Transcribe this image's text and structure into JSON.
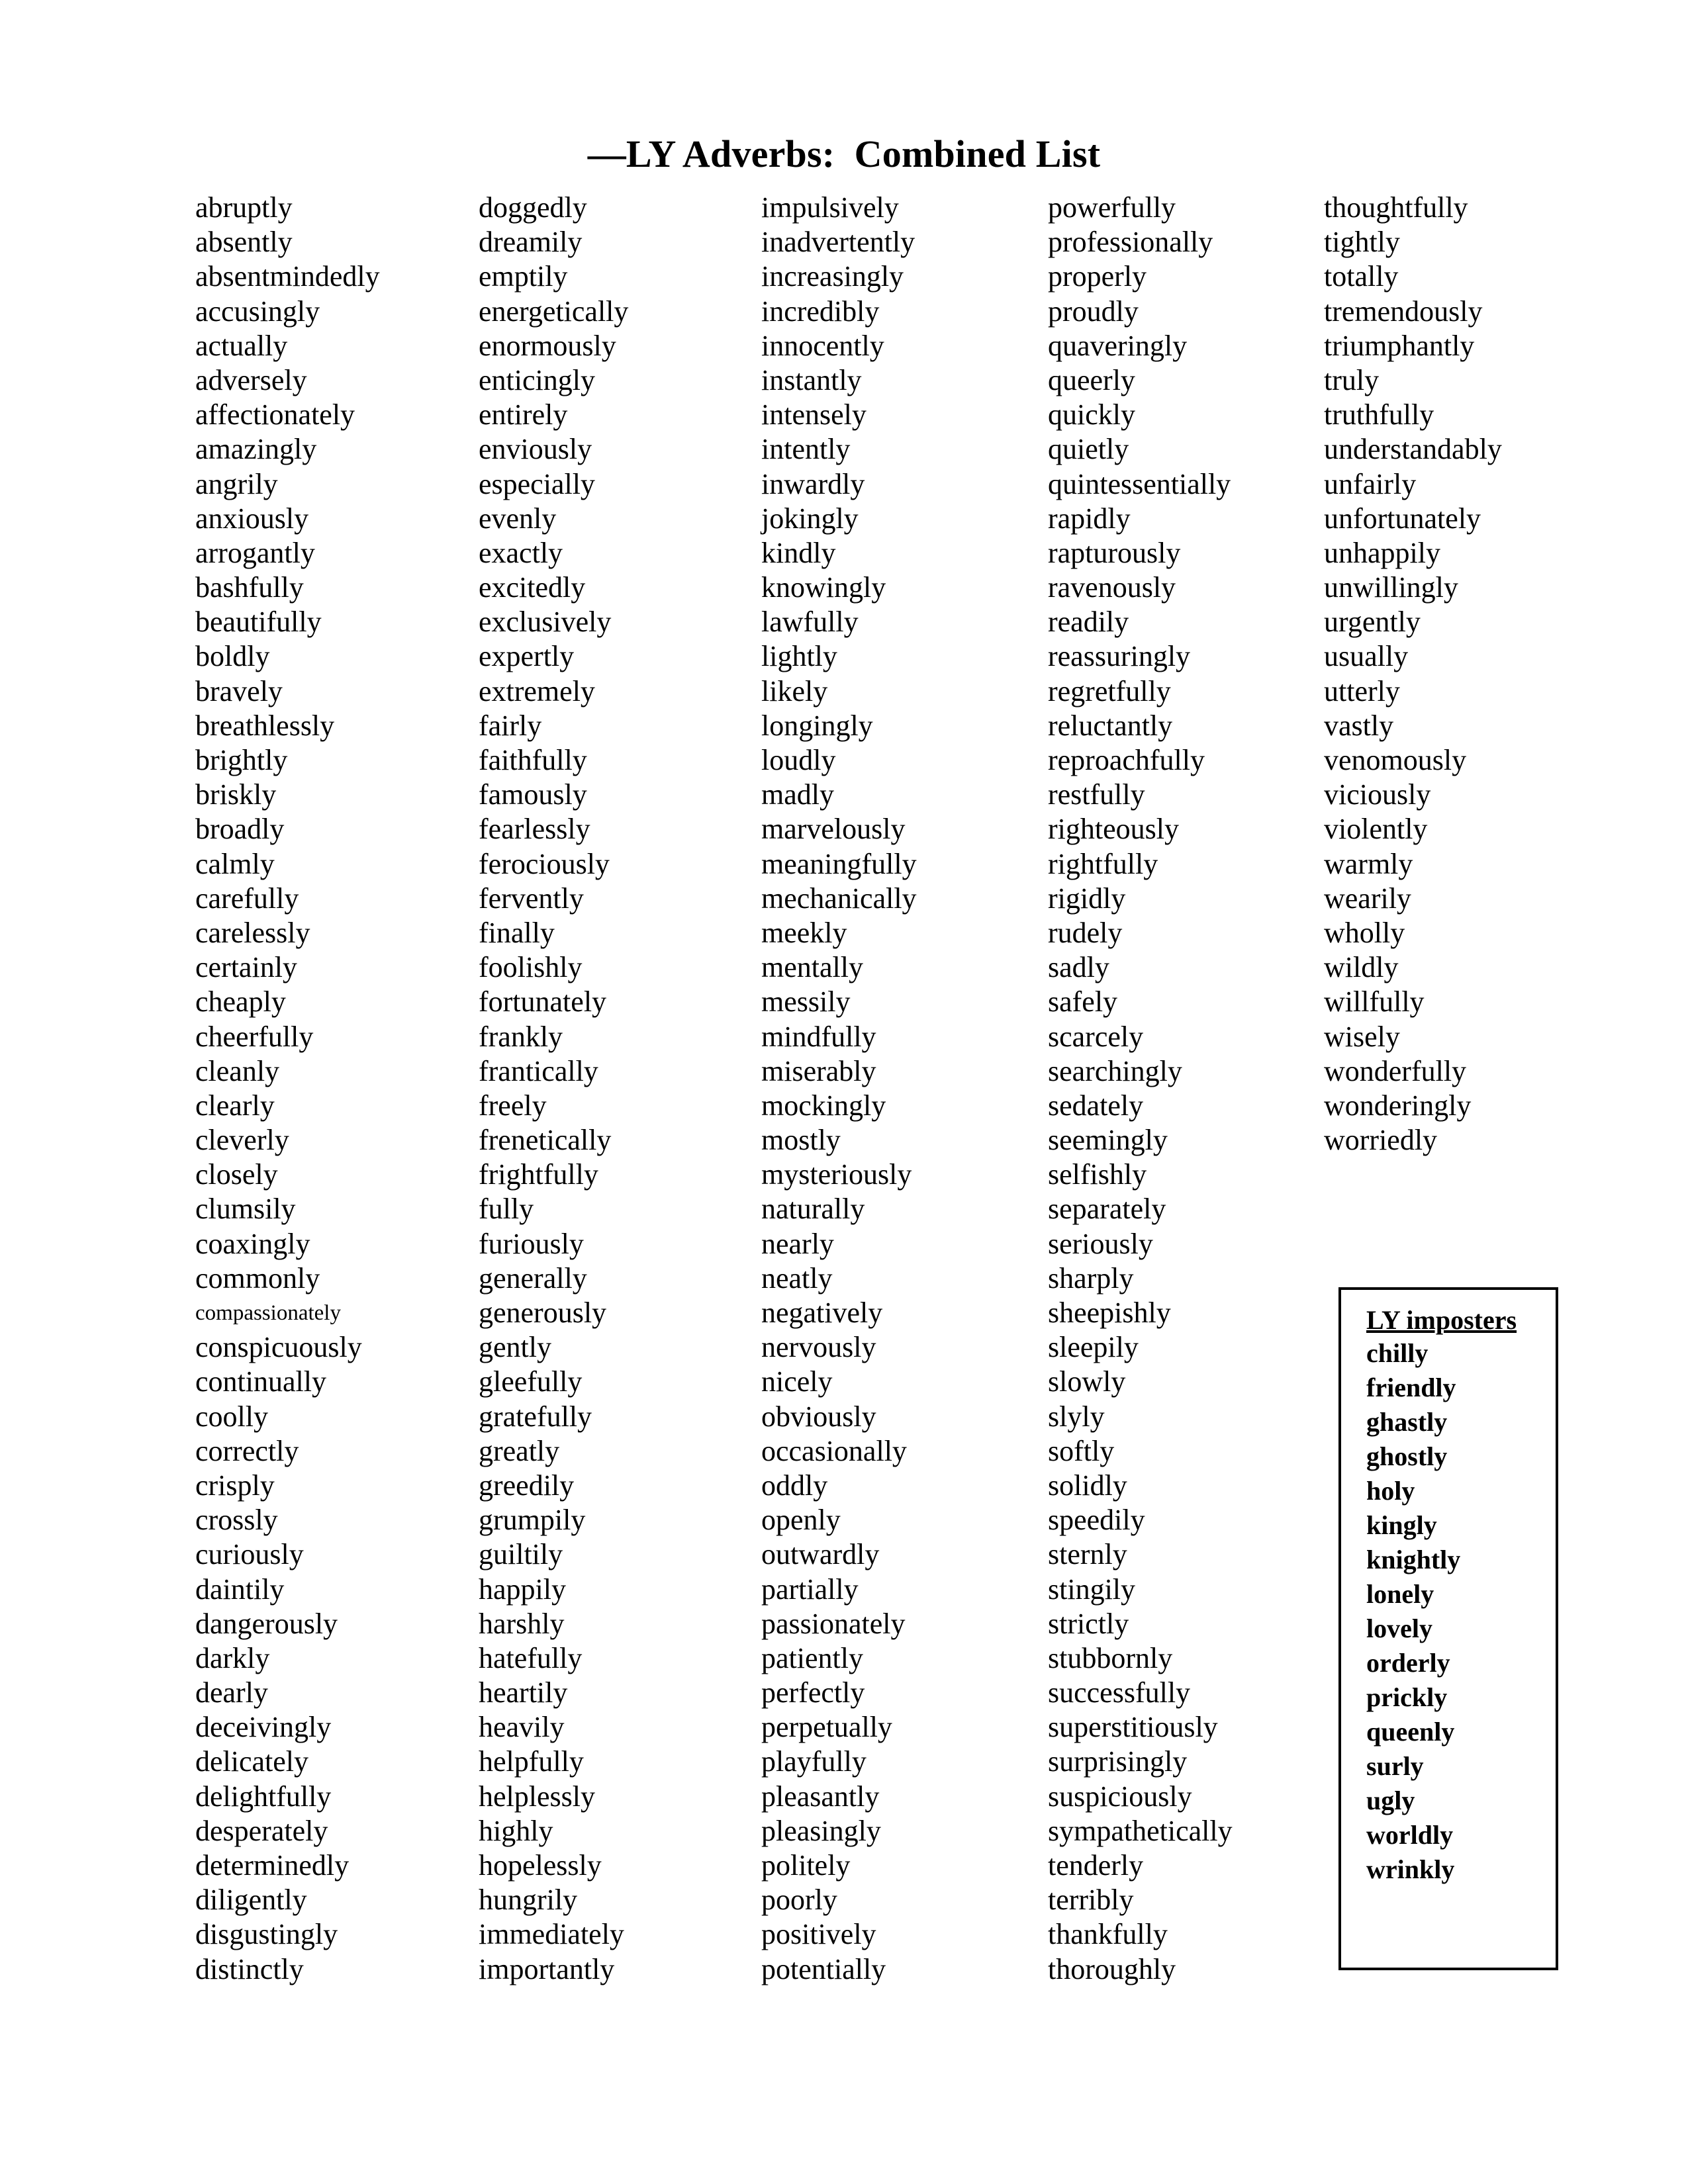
{
  "document": {
    "title": "—LY Adverbs:  Combined List"
  },
  "columns": [
    {
      "id": "column-1",
      "words": [
        "abruptly",
        "absently",
        "absentmindedly",
        "accusingly",
        "actually",
        "adversely",
        "affectionately",
        "amazingly",
        "angrily",
        "anxiously",
        "arrogantly",
        "bashfully",
        "beautifully",
        "boldly",
        "bravely",
        "breathlessly",
        "brightly",
        "briskly",
        "broadly",
        "calmly",
        "carefully",
        "carelessly",
        "certainly",
        "cheaply",
        "cheerfully",
        "cleanly",
        "clearly",
        "cleverly",
        "closely",
        "clumsily",
        "coaxingly",
        "commonly",
        "compassionately",
        "conspicuously",
        "continually",
        "coolly",
        "correctly",
        "crisply",
        "crossly",
        "curiously",
        "daintily",
        "dangerously",
        "darkly",
        "dearly",
        "deceivingly",
        "delicately",
        "delightfully",
        "desperately",
        "determinedly",
        "diligently",
        "disgustingly",
        "distinctly"
      ],
      "small_indices": [
        32
      ]
    },
    {
      "id": "column-2",
      "words": [
        "doggedly",
        "dreamily",
        "emptily",
        "energetically",
        "enormously",
        "enticingly",
        "entirely",
        "enviously",
        "especially",
        "evenly",
        "exactly",
        "excitedly",
        "exclusively",
        "expertly",
        "extremely",
        "fairly",
        "faithfully",
        "famously",
        "fearlessly",
        "ferociously",
        "fervently",
        "finally",
        "foolishly",
        "fortunately",
        "frankly",
        "frantically",
        "freely",
        "frenetically",
        "frightfully",
        "fully",
        "furiously",
        "generally",
        "generously",
        "gently",
        "gleefully",
        "gratefully",
        "greatly",
        "greedily",
        "grumpily",
        "guiltily",
        "happily",
        "harshly",
        "hatefully",
        "heartily",
        "heavily",
        "helpfully",
        "helplessly",
        "highly",
        "hopelessly",
        "hungrily",
        "immediately",
        "importantly"
      ],
      "small_indices": []
    },
    {
      "id": "column-3",
      "words": [
        "impulsively",
        "inadvertently",
        "increasingly",
        "incredibly",
        "innocently",
        "instantly",
        "intensely",
        "intently",
        "inwardly",
        "jokingly",
        "kindly",
        "knowingly",
        "lawfully",
        "lightly",
        "likely",
        "longingly",
        "loudly",
        "madly",
        "marvelously",
        "meaningfully",
        "mechanically",
        "meekly",
        "mentally",
        "messily",
        "mindfully",
        "miserably",
        "mockingly",
        "mostly",
        "mysteriously",
        "naturally",
        "nearly",
        "neatly",
        "negatively",
        "nervously",
        "nicely",
        "obviously",
        "occasionally",
        "oddly",
        "openly",
        "outwardly",
        "partially",
        "passionately",
        "patiently",
        "perfectly",
        "perpetually",
        "playfully",
        "pleasantly",
        "pleasingly",
        "politely",
        "poorly",
        "positively",
        "potentially"
      ],
      "small_indices": []
    },
    {
      "id": "column-4",
      "words": [
        "powerfully",
        "professionally",
        "properly",
        "proudly",
        "quaveringly",
        "queerly",
        "quickly",
        "quietly",
        "quintessentially",
        "rapidly",
        "rapturously",
        "ravenously",
        "readily",
        "reassuringly",
        "regretfully",
        "reluctantly",
        "reproachfully",
        "restfully",
        "righteously",
        "rightfully",
        "rigidly",
        "rudely",
        "sadly",
        "safely",
        "scarcely",
        "searchingly",
        "sedately",
        "seemingly",
        "selfishly",
        "separately",
        "seriously",
        "sharply",
        "sheepishly",
        "sleepily",
        "slowly",
        "slyly",
        "softly",
        "solidly",
        "speedily",
        "sternly",
        "stingily",
        "strictly",
        "stubbornly",
        "successfully",
        "superstitiously",
        "surprisingly",
        "suspiciously",
        "sympathetically",
        "tenderly",
        "terribly",
        "thankfully",
        "thoroughly"
      ],
      "small_indices": []
    },
    {
      "id": "column-5",
      "words": [
        "thoughtfully",
        "tightly",
        "totally",
        "tremendously",
        "triumphantly",
        "truly",
        "truthfully",
        "understandably",
        "unfairly",
        "unfortunately",
        "unhappily",
        "unwillingly",
        "urgently",
        "usually",
        "utterly",
        "vastly",
        "venomously",
        "viciously",
        "violently",
        "warmly",
        "wearily",
        "wholly",
        "wildly",
        "willfully",
        "wisely",
        "wonderfully",
        "wonderingly",
        "worriedly"
      ],
      "small_indices": []
    }
  ],
  "imposters_box": {
    "heading": "LY imposters",
    "words": [
      "chilly",
      "friendly",
      "ghastly",
      "ghostly",
      "holy",
      "kingly",
      "knightly",
      "lonely",
      "lovely",
      "orderly",
      "prickly",
      "queenly",
      "surly",
      "ugly",
      "worldly",
      "wrinkly"
    ]
  }
}
